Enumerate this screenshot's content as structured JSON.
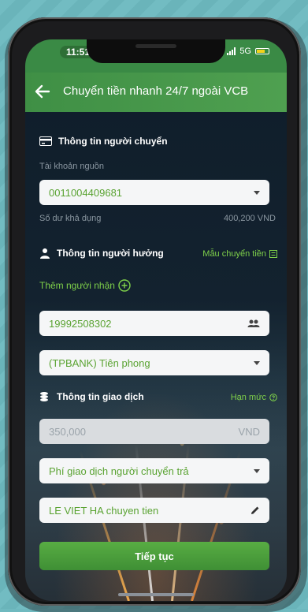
{
  "status": {
    "time": "11:51",
    "network": "5G"
  },
  "header": {
    "title": "Chuyển tiền nhanh 24/7 ngoài VCB"
  },
  "sender": {
    "section_title": "Thông tin người chuyển",
    "source_label": "Tài khoản nguồn",
    "source_account": "0011004409681",
    "balance_label": "Số dư khả dụng",
    "balance_value": "400,200 VND"
  },
  "receiver": {
    "section_title": "Thông tin người hưởng",
    "template_link": "Mẫu chuyển tiền",
    "add_recipient": "Thêm người nhận",
    "account_number": "19992508302",
    "bank": "(TPBANK) Tiên phong"
  },
  "transaction": {
    "section_title": "Thông tin giao dịch",
    "limit_link": "Hạn mức",
    "amount": "350,000",
    "currency": "VND",
    "fee_option": "Phí giao dịch người chuyển trả",
    "content": "LE VIET HA chuyen tien"
  },
  "actions": {
    "continue_label": "Tiếp tục"
  },
  "colors": {
    "accent": "#7fd14a",
    "header": "#3f8f45",
    "field_text": "#5aa332"
  }
}
